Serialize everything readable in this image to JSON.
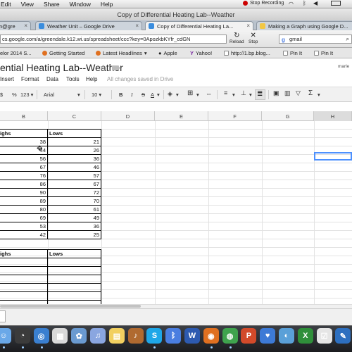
{
  "menubar": {
    "items": [
      "Edit",
      "View",
      "Share",
      "Window",
      "Help"
    ],
    "recording": "Stop Recording"
  },
  "window": {
    "title": "Copy of Differential Heating Lab--Weather"
  },
  "tabs": [
    {
      "label": "n@gre",
      "color": "#c55"
    },
    {
      "label": "Weather Unit – Google Drive",
      "color": "#3a8dde"
    },
    {
      "label": "Copy of Differential Heating La...",
      "color": "#3a8dde"
    },
    {
      "label": "Making a Graph using Google D...",
      "color": "#f2c744"
    }
  ],
  "toolbar": {
    "url": "cs.google.com/a/greendale.k12.wi.us/spreadsheet/ccc?key=0ApozkbKYfr_cdGN",
    "reload": "Reload",
    "stop": "Stop",
    "search": "gmail"
  },
  "bookmarks": [
    "elor 2014 S...",
    "Getting Started",
    "Latest Headlines",
    "Apple",
    "Yahoo!",
    "http://1.bp.blog...",
    "Pin It",
    "Pin It"
  ],
  "doc": {
    "title": "ential Heating Lab--Weather",
    "user": "marle",
    "menu": [
      "Insert",
      "Format",
      "Data",
      "Tools",
      "Help"
    ],
    "saved": "All changes saved in Drive"
  },
  "format": {
    "percent": "%",
    "numfmt": "123",
    "font": "Arial",
    "size": "10",
    "bold": "B",
    "italic": "I",
    "strike": "S",
    "fontcolor": "A",
    "sigma": "Σ"
  },
  "sheet": {
    "columns": [
      "B",
      "C",
      "D",
      "E",
      "F",
      "G",
      "H"
    ],
    "table1": {
      "headers": [
        "ighs",
        "Lows"
      ],
      "rows": [
        [
          "38",
          "21"
        ],
        [
          "44",
          "26"
        ],
        [
          "56",
          "36"
        ],
        [
          "67",
          "46"
        ],
        [
          "76",
          "57"
        ],
        [
          "86",
          "67"
        ],
        [
          "90",
          "72"
        ],
        [
          "89",
          "70"
        ],
        [
          "80",
          "61"
        ],
        [
          "69",
          "49"
        ],
        [
          "53",
          "36"
        ],
        [
          "42",
          "25"
        ]
      ]
    },
    "table2": {
      "headers": [
        "ighs",
        "Lows"
      ]
    }
  },
  "dock": [
    "finder",
    "dashboard",
    "safari",
    "ical",
    "photos",
    "itunes",
    "stickies",
    "guitar",
    "skype",
    "bluetooth",
    "word",
    "firefox",
    "chrome",
    "powerpoint",
    "keynote",
    "photo",
    "excel",
    "reminders",
    "smart"
  ]
}
